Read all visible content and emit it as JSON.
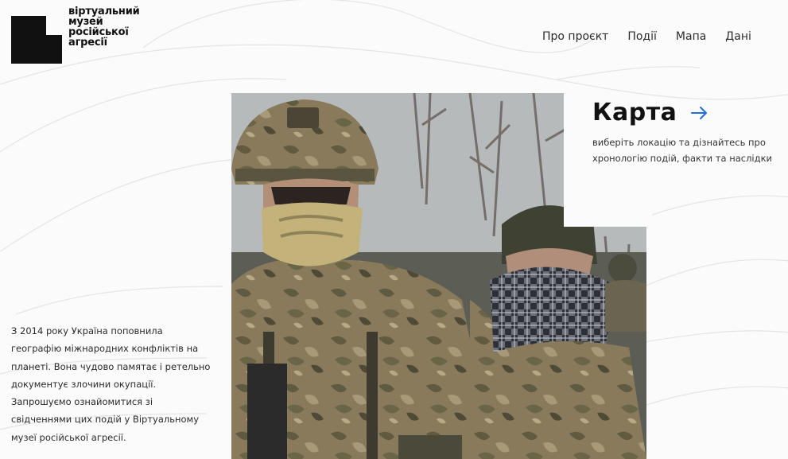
{
  "brand": {
    "name_lines": [
      "віртуальний",
      "музей",
      "російської",
      "агресії"
    ]
  },
  "nav": {
    "items": [
      "Про проєкт",
      "Події",
      "Мапа",
      "Дані"
    ]
  },
  "map_card": {
    "title": "Карта",
    "description": "виберіть локацію та дізнайтесь про хронологію подій, факти та наслідки",
    "arrow_icon": "arrow-right-icon",
    "accent_color": "#1f6fe0"
  },
  "intro": {
    "text": "З 2014 року Україна поповнила географію міжнародних конфліктів на планеті. Вона чудово памятає і ретельно документує злочини окупації. Запрошуємо ознайомитися зі свідченнями цих подій у Віртуальному музеї російської агресії."
  },
  "photo": {
    "alt": "Soldiers in camouflage and helmets"
  }
}
